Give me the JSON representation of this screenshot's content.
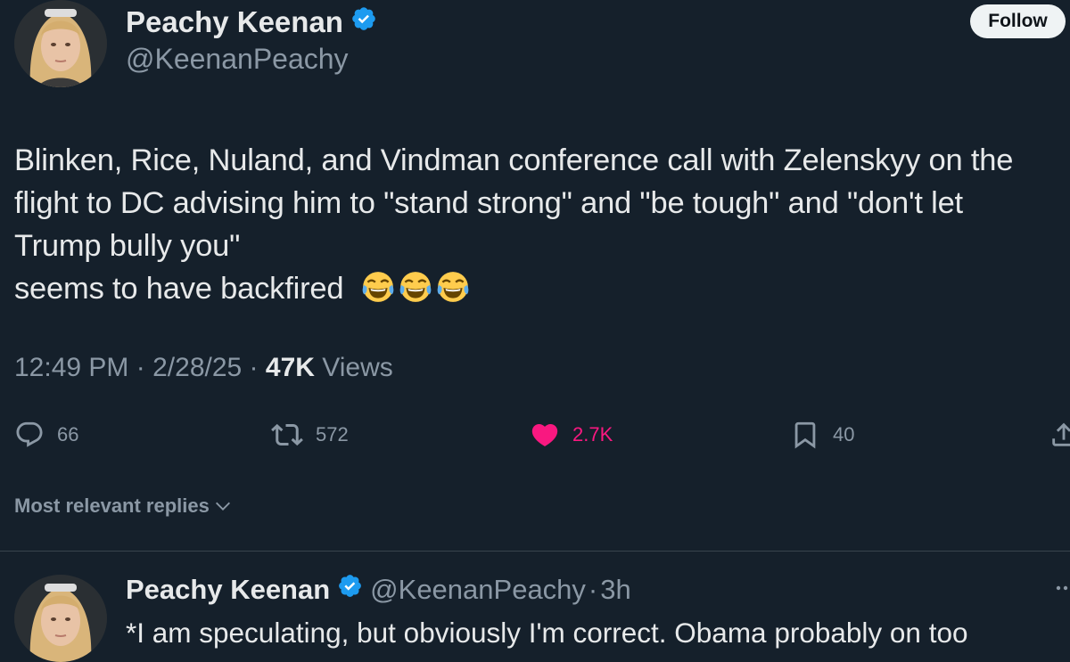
{
  "tweet": {
    "author": {
      "name": "Peachy Keenan",
      "handle": "@KeenanPeachy"
    },
    "follow_label": "Follow",
    "text_lines": [
      "Blinken, Rice, Nuland, and Vindman conference call with Zelenskyy on the",
      "flight to DC advising him to \"stand strong\" and \"be tough\" and \"don't let",
      "Trump bully you\"",
      "seems to have backfired"
    ],
    "emoji": [
      "face-with-tears-of-joy",
      "face-with-tears-of-joy",
      "face-with-tears-of-joy"
    ],
    "time": "12:49 PM",
    "date": "2/28/25",
    "views_count": "47K",
    "views_label": "Views",
    "separator": "·",
    "actions": {
      "replies": "66",
      "reposts": "572",
      "likes": "2.7K",
      "bookmarks": "40"
    },
    "icons": [
      "reply-icon",
      "repost-icon",
      "heart-icon",
      "bookmark-icon",
      "share-icon",
      "verified-badge-icon"
    ],
    "colors": {
      "background": "#15202b",
      "like": "#f91880",
      "verified": "#1d9bf0"
    }
  },
  "replies_sort_label": "Most relevant replies",
  "reply": {
    "name": "Peachy Keenan",
    "handle": "@KeenanPeachy",
    "separator": "·",
    "age": "3h",
    "text": "*I am speculating, but obviously I'm correct. Obama probably on too"
  }
}
